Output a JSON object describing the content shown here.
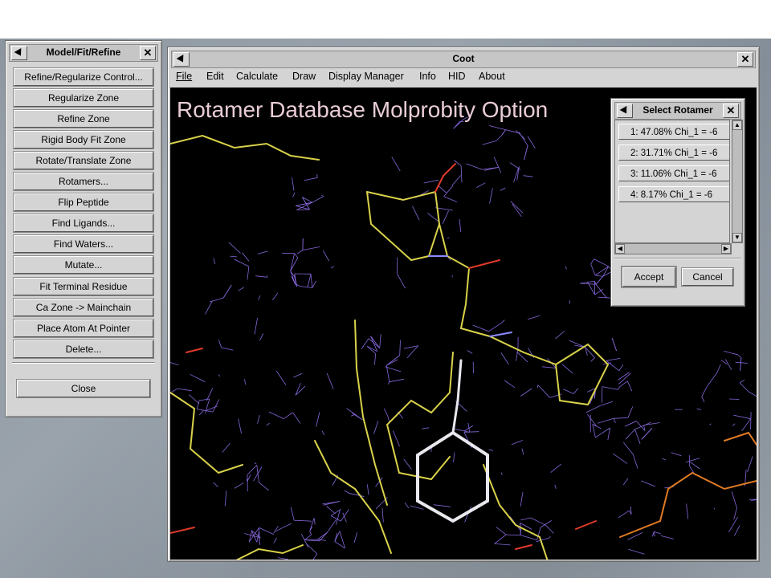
{
  "model_fit_refine": {
    "title": "Model/Fit/Refine",
    "buttons": [
      "Refine/Regularize Control...",
      "Regularize Zone",
      "Refine Zone",
      "Rigid Body Fit Zone",
      "Rotate/Translate Zone",
      "Rotamers...",
      "Flip Peptide",
      "Find Ligands...",
      "Find Waters...",
      "Mutate...",
      "Fit Terminal Residue",
      "Ca Zone -> Mainchain",
      "Place Atom At Pointer",
      "Delete..."
    ],
    "close_label": "Close"
  },
  "coot": {
    "title": "Coot",
    "menu": [
      "File",
      "Edit",
      "Calculate",
      "Draw",
      "Display Manager",
      "Info",
      "HID",
      "About"
    ],
    "overlay_title": "Rotamer Database Molprobity Option"
  },
  "select_rotamer": {
    "title": "Select Rotamer",
    "rows": [
      "1:   47.08% Chi_1 = -6",
      "2:   31.71% Chi_1 = -6",
      "3:   11.06% Chi_1 = -6",
      "4:    8.17% Chi_1 = -6"
    ],
    "accept_label": "Accept",
    "cancel_label": "Cancel"
  },
  "colors": {
    "density_mesh": "#8f6ee8",
    "carbon": "#d9d24a",
    "nitrogen": "#8a8aff",
    "oxygen": "#e03a2a",
    "selected_ring": "#e8e8ee",
    "overlay_text": "#e9ccd8"
  },
  "icons": {
    "window_menu": "window-menu-icon",
    "window_close": "close-icon"
  }
}
